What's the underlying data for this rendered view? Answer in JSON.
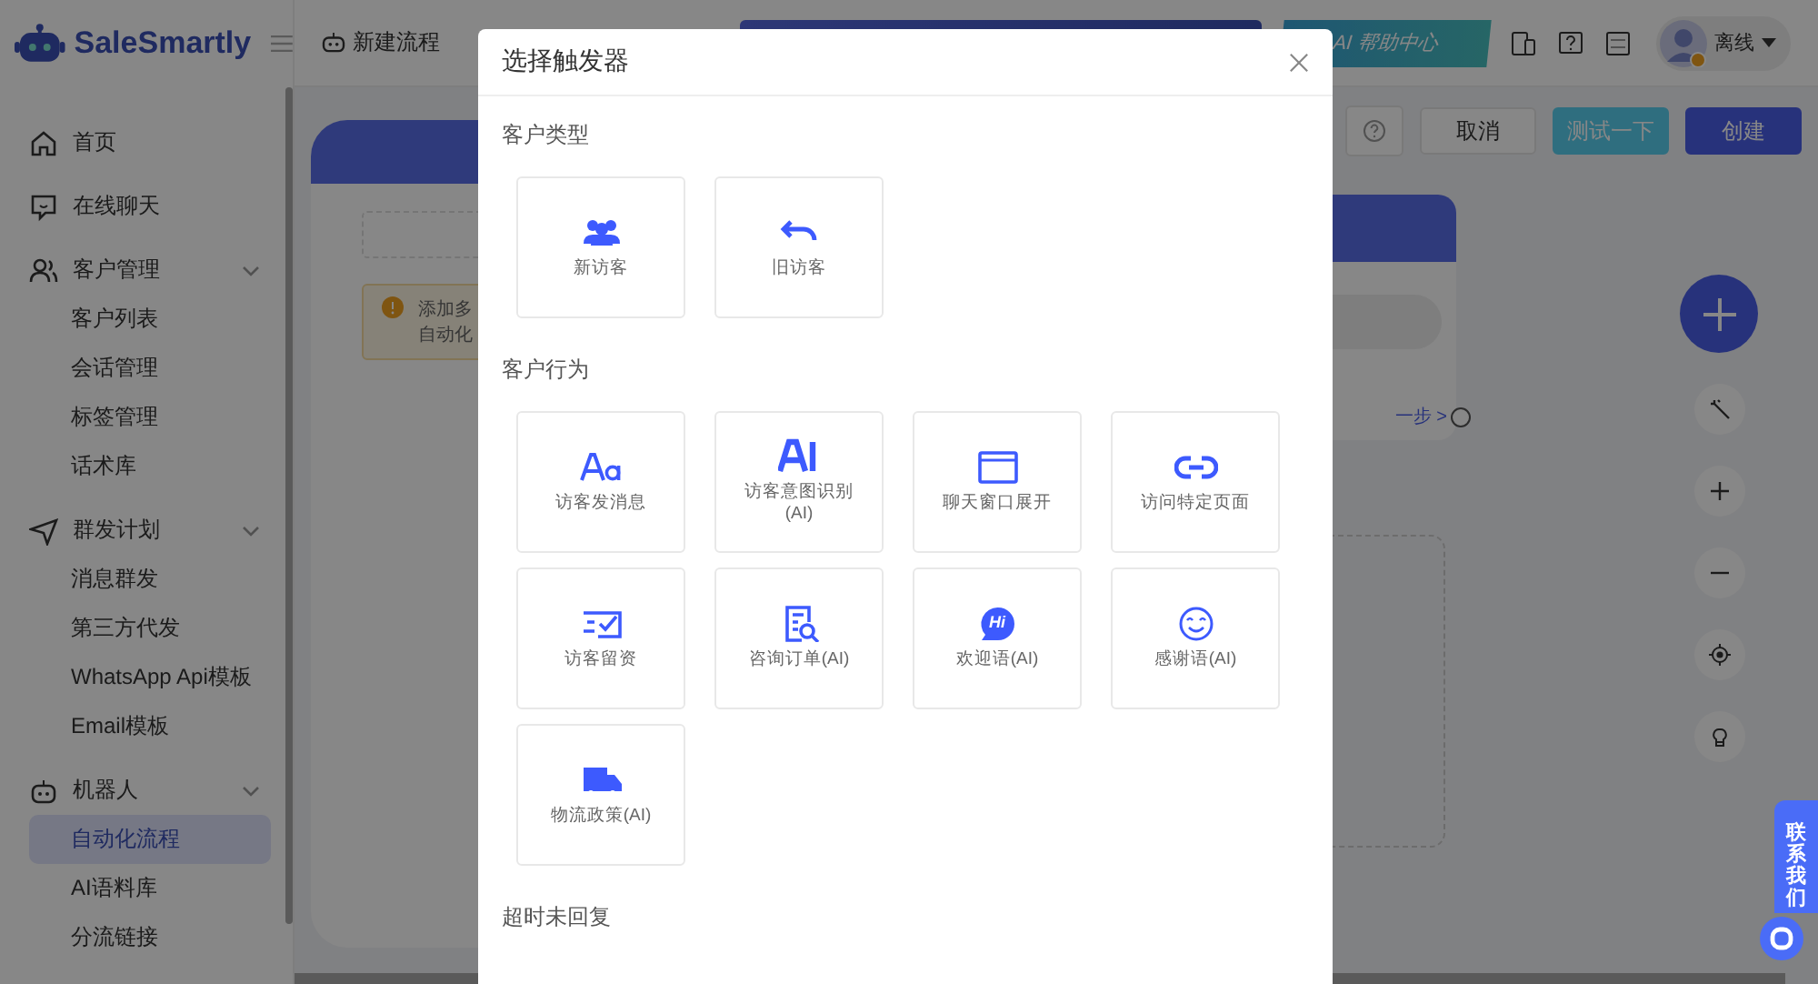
{
  "brand": {
    "name": "SaleSmartly"
  },
  "sidebar": {
    "items": [
      {
        "label": "首页"
      },
      {
        "label": "在线聊天"
      },
      {
        "label": "客户管理",
        "expanded": true,
        "children": [
          {
            "label": "客户列表",
            "selected": false
          },
          {
            "label": "会话管理",
            "selected": false
          },
          {
            "label": "标签管理",
            "selected": false
          },
          {
            "label": "话术库",
            "selected": false
          }
        ]
      },
      {
        "label": "群发计划",
        "expanded": true,
        "children": [
          {
            "label": "消息群发",
            "selected": false
          },
          {
            "label": "第三方代发",
            "selected": false
          },
          {
            "label": "WhatsApp Api模板",
            "selected": false
          },
          {
            "label": "Email模板",
            "selected": false
          }
        ]
      },
      {
        "label": "机器人",
        "expanded": true,
        "children": [
          {
            "label": "自动化流程",
            "selected": true
          },
          {
            "label": "AI语料库",
            "selected": false
          },
          {
            "label": "分流链接",
            "selected": false
          }
        ]
      }
    ]
  },
  "topbar": {
    "page_title": "新建流程",
    "help_center": "AI 帮助中心",
    "status": "离线"
  },
  "toolbar": {
    "buttons": [
      {
        "label": "取消",
        "kind": "plain"
      },
      {
        "label": "测试一下",
        "kind": "test"
      },
      {
        "label": "创建",
        "kind": "primary"
      }
    ]
  },
  "canvas": {
    "notice_lines": [
      "添加多",
      "自动化"
    ],
    "next_step": "一步 >"
  },
  "modal": {
    "title": "选择触发器",
    "sections": [
      {
        "title": "客户类型",
        "items": [
          {
            "label": "新访客"
          },
          {
            "label": "旧访客"
          }
        ]
      },
      {
        "title": "客户行为",
        "items": [
          {
            "label": "访客发消息"
          },
          {
            "label": "访客意图识别\n(AI)"
          },
          {
            "label": "聊天窗口展开"
          },
          {
            "label": "访问特定页面"
          },
          {
            "label": "访客留资"
          },
          {
            "label": "咨询订单(AI)"
          },
          {
            "label": "欢迎语(AI)",
            "icon_text": "Hi"
          },
          {
            "label": "感谢语(AI)"
          },
          {
            "label": "物流政策(AI)"
          }
        ]
      },
      {
        "title": "超时未回复"
      }
    ]
  },
  "contact": {
    "label": "联系我们"
  }
}
